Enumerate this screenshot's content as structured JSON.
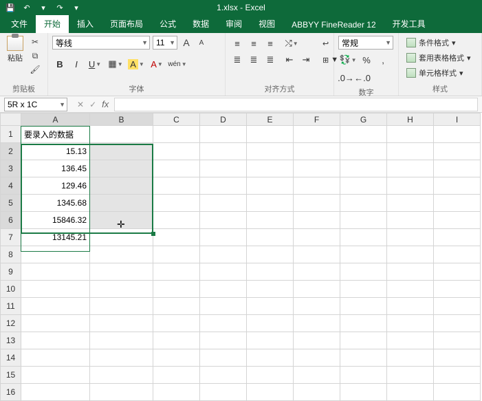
{
  "app": {
    "title": "1.xlsx - Excel"
  },
  "qat": {
    "save": "💾",
    "undo": "↶",
    "redo": "↷",
    "more": "▾"
  },
  "tabs": {
    "file": "文件",
    "home": "开始",
    "insert": "插入",
    "pagelayout": "页面布局",
    "formulas": "公式",
    "data": "数据",
    "review": "审阅",
    "view": "视图",
    "abbyy": "ABBYY FineReader 12",
    "dev": "开发工具"
  },
  "ribbon": {
    "clipboard": {
      "paste": "粘贴",
      "label": "剪贴板"
    },
    "font": {
      "name": "等线",
      "size": "11",
      "label": "字体",
      "wen": "wén"
    },
    "align": {
      "label": "对齐方式"
    },
    "number": {
      "format": "常规",
      "label": "数字"
    },
    "styles": {
      "cond": "条件格式",
      "table": "套用表格格式",
      "cell": "单元格样式",
      "label": "样式"
    }
  },
  "namebox": {
    "value": "5R x 1C"
  },
  "fx": {
    "cancel": "✕",
    "enter": "✓",
    "fx": "fx"
  },
  "sheet": {
    "cols": [
      "A",
      "B",
      "C",
      "D",
      "E",
      "F",
      "G",
      "H",
      "I"
    ],
    "rows": [
      "1",
      "2",
      "3",
      "4",
      "5",
      "6",
      "7",
      "8",
      "9",
      "10",
      "11",
      "12",
      "13",
      "14",
      "15",
      "16"
    ],
    "a1": "要录入的数据",
    "data": [
      "15.13",
      "136.45",
      "129.46",
      "1345.68",
      "15846.32",
      "13145.21"
    ]
  },
  "chart_data": {
    "type": "table",
    "title": "要录入的数据",
    "columns": [
      "A"
    ],
    "values": [
      15.13,
      136.45,
      129.46,
      1345.68,
      15846.32,
      13145.21
    ]
  }
}
